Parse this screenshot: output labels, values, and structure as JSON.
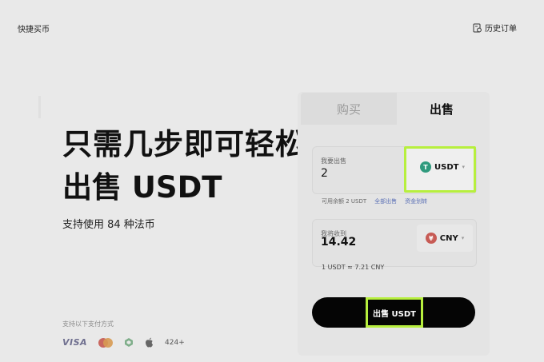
{
  "header": {
    "title": "快捷买币",
    "history_label": "历史订单",
    "history_icon": "order-history-icon"
  },
  "hero": {
    "line1": "只需几步即可轻松",
    "line2": "出售 USDT",
    "subtitle": "支持使用 84 种法币"
  },
  "payment": {
    "label": "支持以下支付方式",
    "methods": [
      "VISA",
      "mastercard-icon",
      "google-pay-icon",
      "apple-pay-icon"
    ],
    "more": "424+"
  },
  "tabs": {
    "buy": "购买",
    "sell": "出售"
  },
  "spend": {
    "label": "我要出售",
    "value": "2",
    "currency": "USDT",
    "currency_icon": "tether-icon"
  },
  "balance": {
    "text": "可用余额 2 USDT",
    "link1": "全部出售",
    "link2": "资金划转"
  },
  "receive": {
    "label": "我将收到",
    "value": "14.42",
    "currency": "CNY",
    "currency_icon": "cny-icon"
  },
  "rate": "1 USDT ≈ 7.21 CNY",
  "action": {
    "sell_button": "出售 USDT"
  },
  "colors": {
    "highlight": "#b7ef3e",
    "button_bg": "#050505",
    "tether": "#2f9a7d",
    "link": "#5a6fb5"
  }
}
